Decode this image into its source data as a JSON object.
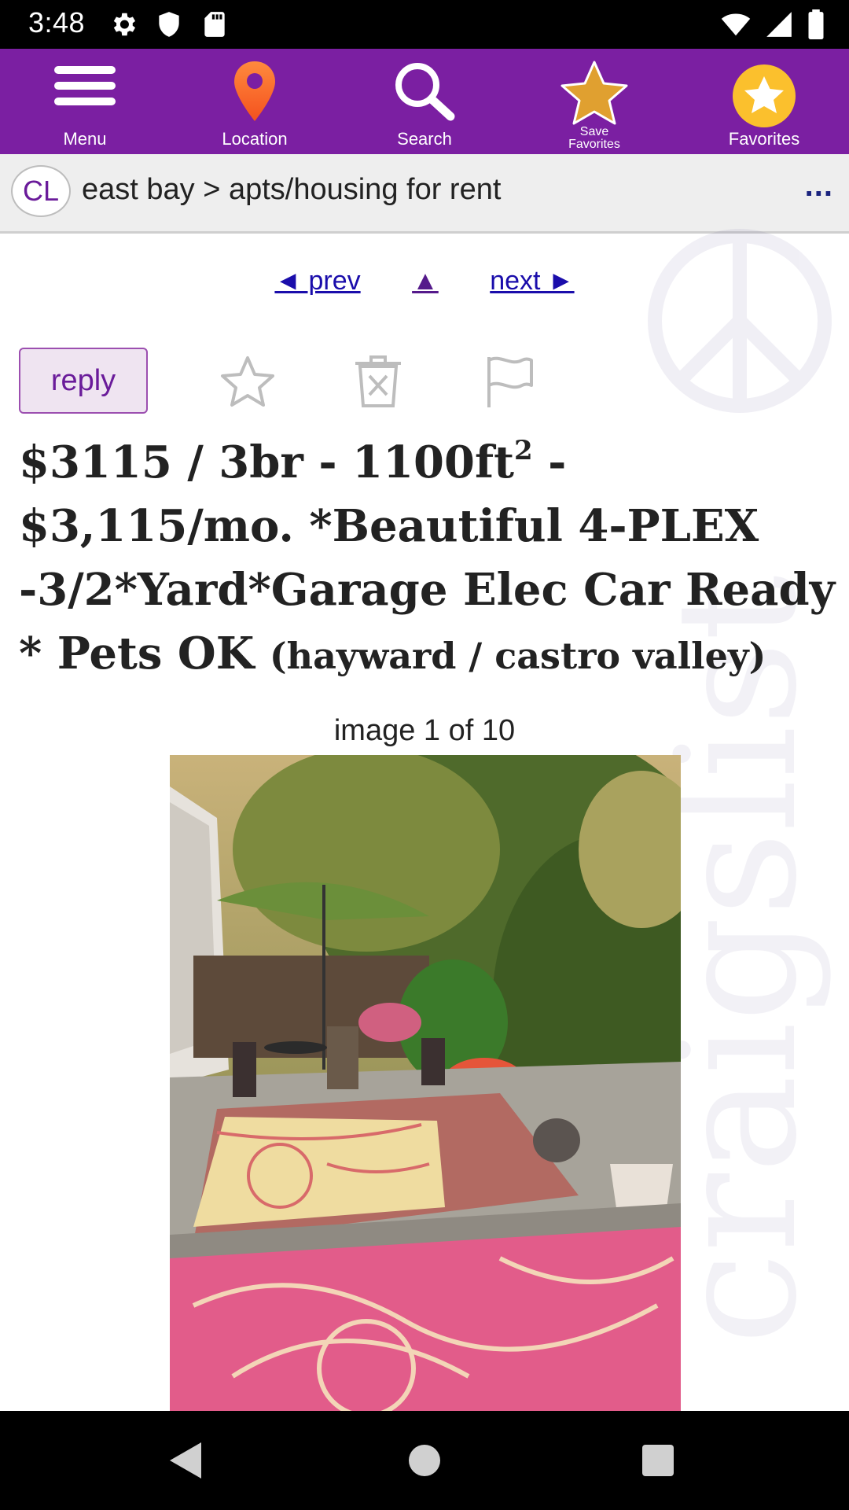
{
  "status_bar": {
    "time": "3:48",
    "left_icons": [
      "gear-icon",
      "shield-icon",
      "sd-card-icon"
    ],
    "right_icons": [
      "wifi-icon",
      "signal-icon",
      "battery-icon"
    ]
  },
  "toolbar": {
    "background": "#7b1fa2",
    "items": [
      {
        "label": "Menu",
        "icon": "hamburger-menu-icon"
      },
      {
        "label": "Location",
        "icon": "map-pin-icon"
      },
      {
        "label": "Search",
        "icon": "magnifier-icon"
      },
      {
        "label": "Save Favorites",
        "icon": "star-icon"
      },
      {
        "label": "Favorites",
        "icon": "star-circle-icon"
      }
    ]
  },
  "breadcrumb": {
    "badge": "CL",
    "path": "east bay > apts/housing for rent",
    "more": "..."
  },
  "nav": {
    "prev": "◄ prev",
    "up": "▲",
    "next": "next ►"
  },
  "actions": {
    "reply": "reply",
    "icons": [
      "star-outline-icon",
      "trash-x-icon",
      "flag-icon"
    ]
  },
  "listing": {
    "title_part1": "$3115 / 3br - 1100ft",
    "title_sup": "2",
    "title_part2": " - $3,115/mo. *Beautiful 4-PLEX -3/2*Yard*Garage Elec Car Ready * Pets OK ",
    "location": "(hayward / castro valley)",
    "image_count": "image 1 of 10"
  },
  "watermark": {
    "text": "craigslist"
  },
  "bottom_nav": {
    "icons": [
      "back-triangle-icon",
      "home-circle-icon",
      "recents-square-icon"
    ]
  }
}
